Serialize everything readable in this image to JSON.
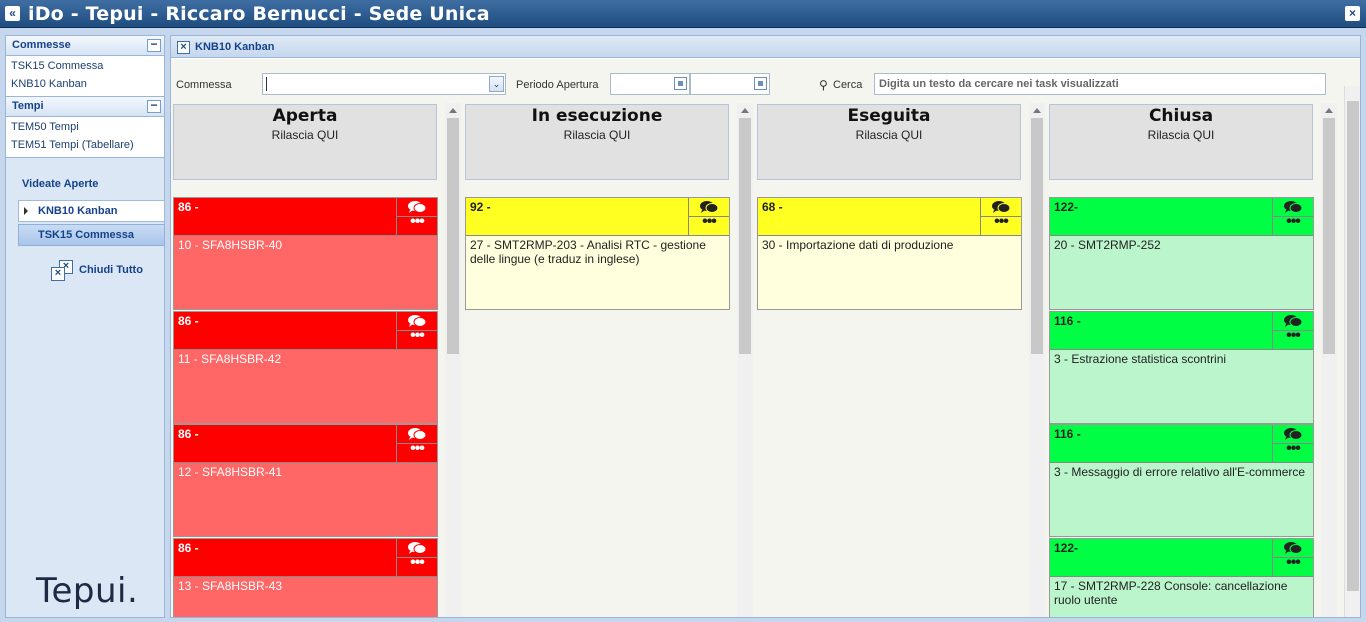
{
  "app": {
    "title": "iDo - Tepui - Riccaro Bernucci - Sede Unica",
    "collapse_icon": "«",
    "close_icon": "×"
  },
  "sidebar": {
    "commesse": {
      "title": "Commesse",
      "minimize_icon": "−",
      "links": [
        "TSK15 Commessa",
        "KNB10 Kanban"
      ]
    },
    "tempi": {
      "title": "Tempi",
      "minimize_icon": "−",
      "links": [
        "TEM50 Tempi",
        "TEM51 Tempi (Tabellare)"
      ]
    },
    "videate": {
      "title": "Videate Aperte",
      "items": [
        "KNB10 Kanban",
        "TSK15 Commessa"
      ]
    },
    "close_all_label": "Chiudi Tutto",
    "logo": "Tepui."
  },
  "main": {
    "tab_title": "KNB10 Kanban",
    "filters": {
      "commessa_label": "Commessa",
      "commessa_value": "",
      "periodo_label": "Periodo Apertura",
      "periodo_from": "",
      "periodo_to": "",
      "search_label": "Cerca",
      "search_placeholder": "Digita un testo da cercare nei task visualizzati"
    },
    "columns": [
      {
        "name": "Aperta",
        "drop_label": "Rilascia QUI",
        "color": "#ff0000",
        "cards": [
          {
            "num": "86 -",
            "desc": "10 - SFA8HSBR-40"
          },
          {
            "num": "86 -",
            "desc": "11 - SFA8HSBR-42"
          },
          {
            "num": "86 -",
            "desc": "12 - SFA8HSBR-41"
          },
          {
            "num": "86 -",
            "desc": "13 - SFA8HSBR-43"
          }
        ]
      },
      {
        "name": "In esecuzione",
        "drop_label": "Rilascia QUI",
        "color": "#ffff22",
        "cards": [
          {
            "num": "92 -",
            "desc": "27 - SMT2RMP-203 - Analisi RTC - gestione delle lingue (e traduz in inglese)"
          }
        ]
      },
      {
        "name": "Eseguita",
        "drop_label": "Rilascia QUI",
        "color": "#ffff22",
        "cards": [
          {
            "num": "68 -",
            "desc": "30 - Importazione dati di produzione"
          }
        ]
      },
      {
        "name": "Chiusa",
        "drop_label": "Rilascia QUI",
        "color": "#00ff44",
        "cards": [
          {
            "num": "122-",
            "desc": "20 - SMT2RMP-252"
          },
          {
            "num": "116 -",
            "desc": "3 - Estrazione statistica scontrini"
          },
          {
            "num": "116 -",
            "desc": "3 - Messaggio di errore relativo all'E-commerce"
          },
          {
            "num": "122-",
            "desc": "17 - SMT2RMP-228 Console: cancellazione ruolo utente"
          }
        ]
      }
    ],
    "card_more_icon": "•••"
  }
}
